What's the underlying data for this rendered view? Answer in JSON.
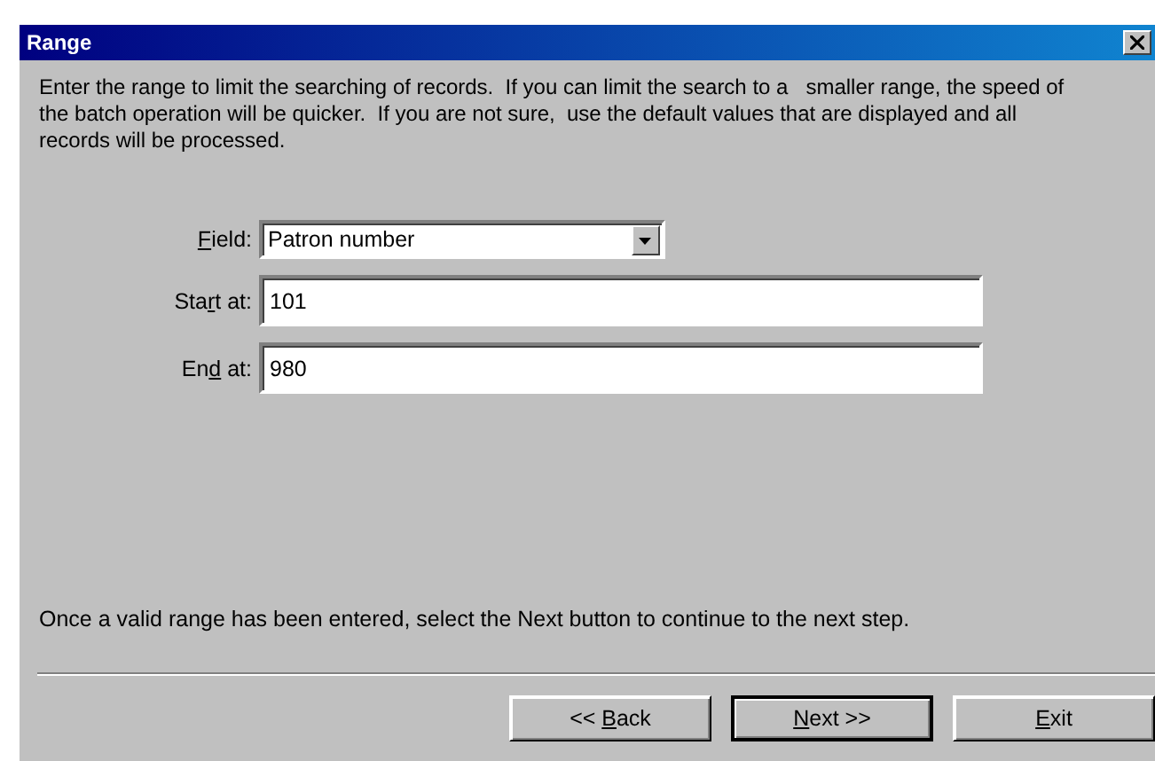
{
  "window": {
    "title": "Range"
  },
  "intro": "Enter the range to limit the searching of records.  If you can limit the search to a   smaller range, the speed of the batch operation will be quicker.  If you are not sure,  use the default values that are displayed and all records will be processed.",
  "fields": [
    {
      "kind": "dropdown",
      "label": {
        "key": "F",
        "post": "ield:"
      },
      "value": "Patron number"
    },
    {
      "kind": "text",
      "label": {
        "pre": "Sta",
        "key": "r",
        "post": "t at:"
      },
      "value": "101"
    },
    {
      "kind": "text",
      "label": {
        "pre": "En",
        "key": "d",
        "post": " at:"
      },
      "value": "980"
    }
  ],
  "hint": "Once a valid range has been entered, select the Next button to continue to the next step.",
  "buttons": [
    {
      "label": {
        "pre": "<< ",
        "key": "B",
        "post": "ack"
      },
      "default": false
    },
    {
      "label": {
        "key": "N",
        "post": "ext >>"
      },
      "default": true
    },
    {
      "label": {
        "key": "E",
        "post": "xit"
      },
      "default": false
    }
  ]
}
